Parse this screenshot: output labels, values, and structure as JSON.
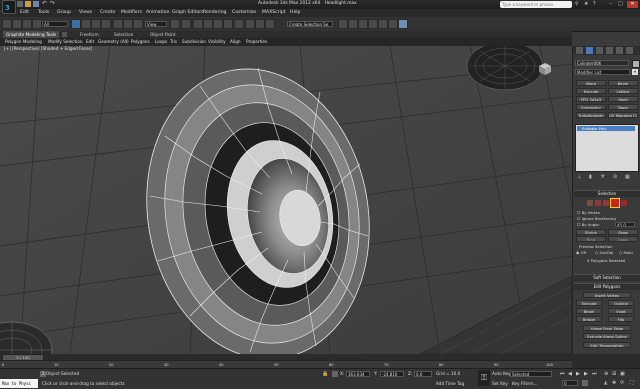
{
  "app": {
    "title": "Autodesk 3ds Max 2012 x64",
    "file": "Headlight.max",
    "search_placeholder": "Type a keyword or phrase",
    "accent": "#2a7fd4"
  },
  "menu": [
    "Edit",
    "Tools",
    "Group",
    "Views",
    "Create",
    "Modifiers",
    "Animation",
    "Graph Editors",
    "Rendering",
    "Customize",
    "MAXScript",
    "Help"
  ],
  "toolbar": {
    "selection_filter": "All",
    "view": "View",
    "named_selection": "Create Selection Se"
  },
  "ribbon": {
    "tabs": [
      "Graphite Modeling Tools",
      "Freeform",
      "Selection",
      "Object Paint"
    ],
    "subtabs": [
      "Polygon Modeling",
      "Modify Selection",
      "Edit",
      "Geometry (All)",
      "Polygons",
      "Loops",
      "Tris",
      "Subdivision",
      "Visibility",
      "Align",
      "Properties"
    ]
  },
  "viewport": {
    "label": "[+] [Perspective] [Shaded + Edged Faces]"
  },
  "command_panel": {
    "object_name": "Cylinder006",
    "modifier_list": "Modifier List",
    "mod_buttons": [
      "Bend",
      "Bevel",
      "Extrude",
      "Lattice",
      "FFD 3x3x3",
      "Shell",
      "Symmetry",
      "Taper",
      "TurboSmooth",
      "UV Mapping Cle"
    ],
    "stack_item": "Editable Poly",
    "selection": {
      "title": "Selection",
      "by_vertex": "By Vertex",
      "ignore_backfacing": "Ignore Backfacing",
      "by_angle": "By Angle:",
      "angle_value": "45.0",
      "shrink": "Shrink",
      "grow": "Grow",
      "ring": "Ring",
      "loop": "Loop",
      "preview_selection": "Preview Selection",
      "off": "Off",
      "subobj": "SubObj",
      "multi": "Multi",
      "status": "0 Polygons Selected"
    },
    "soft_selection": "Soft Selection",
    "edit_polygons": "Edit Polygons",
    "insert_vertex": "Insert Vertex",
    "edit_buttons": [
      "Extrude",
      "Outline",
      "Bevel",
      "Inset",
      "Bridge",
      "Flip"
    ],
    "hinge": "Hinge From Edge",
    "extrude_spline": "Extrude Along Spline",
    "edit_triangulation": "Edit Triangulation",
    "retriangulate": "Retriangulate",
    "turn": "Turn"
  },
  "timeline": {
    "slider": "0 / 100",
    "ticks": [
      "0",
      "10",
      "20",
      "30",
      "40",
      "50",
      "60",
      "70",
      "80",
      "90",
      "100"
    ]
  },
  "status": {
    "listener": "Max to Physc",
    "selected": "1 Object Selected",
    "prompt": "Click or click-and-drag to select objects",
    "x_label": "X:",
    "x_value": "363.634",
    "y_label": "Y:",
    "y_value": "-24.816",
    "z_label": "Z:",
    "z_value": "0.0",
    "grid": "Grid = 10.0",
    "add_time_tag": "Add Time Tag",
    "auto_key": "Auto Key",
    "set_key": "Set Key",
    "key_mode": "Selected",
    "key_filters": "Key Filters...",
    "frame": "0"
  }
}
